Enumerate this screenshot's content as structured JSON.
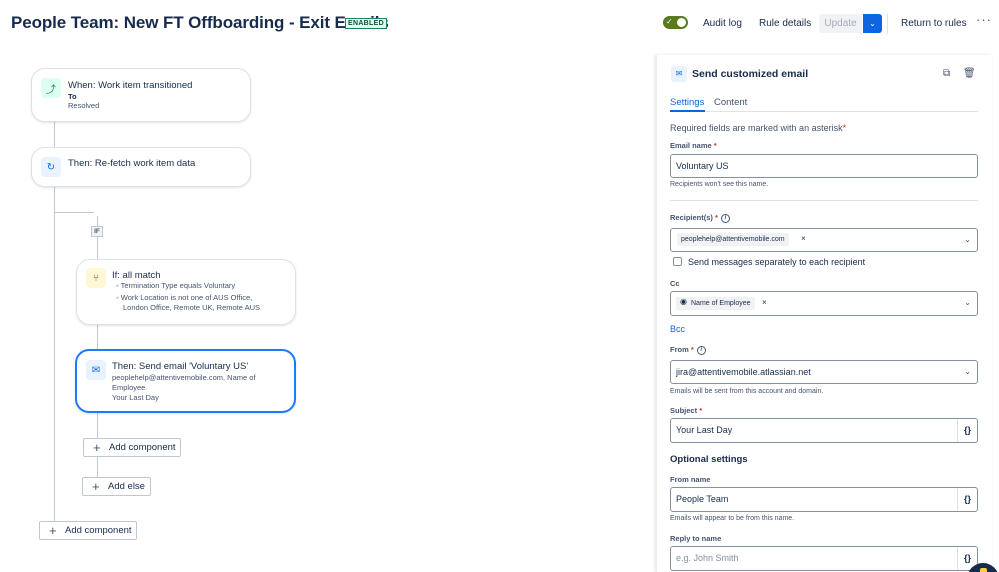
{
  "header": {
    "title": "People Team: New FT Offboarding - Exit Emails",
    "status_badge": "ENABLED",
    "audit_log": "Audit log",
    "rule_details": "Rule details",
    "update": "Update",
    "return_to_rules": "Return to rules"
  },
  "canvas": {
    "trigger": {
      "title": "When: Work item transitioned",
      "to_label": "To",
      "to_value": "Resolved"
    },
    "refetch": {
      "title": "Then: Re-fetch work item data"
    },
    "if_chip": "IF",
    "condition": {
      "title": "If: all match",
      "items": [
        "Termination Type equals Voluntary",
        "Work Location is not one of AUS Office,",
        "London Office, Remote UK, Remote AUS"
      ]
    },
    "send_email": {
      "title": "Then: Send email 'Voluntary US'",
      "lines": [
        "peoplehelp@attentivemobile.com, Name of",
        "Employee",
        "Your Last Day"
      ]
    },
    "add_component_inner": "Add component",
    "add_else": "Add else",
    "add_component_outer": "Add component"
  },
  "panel": {
    "title": "Send customized email",
    "tabs": [
      "Settings",
      "Content"
    ],
    "required_note": "Required fields are marked with an asterisk",
    "email_name": {
      "label": "Email name",
      "value": "Voluntary US",
      "help": "Recipients won't see this name."
    },
    "recipients": {
      "label": "Recipient(s)",
      "chip": "peoplehelp@attentivemobile.com",
      "chip_remove": "×"
    },
    "send_separately": "Send messages separately to each recipient",
    "cc": {
      "label": "Cc",
      "chip": "Name of Employee",
      "chip_remove": "×"
    },
    "bcc": "Bcc",
    "from": {
      "label": "From",
      "value": "jira@attentivemobile.atlassian.net",
      "help": "Emails will be sent from this account and domain."
    },
    "subject": {
      "label": "Subject",
      "value": "Your Last Day"
    },
    "optional_heading": "Optional settings",
    "from_name": {
      "label": "From name",
      "value": "People Team",
      "help": "Emails will appear to be from this name."
    },
    "reply_to_name": {
      "label": "Reply to name",
      "placeholder": "e.g. John Smith"
    },
    "required_star": "*",
    "brace_symbol": "{}"
  },
  "colors": {
    "accent": "#0c66e4",
    "toggle_on": "#5a7a1f",
    "badge_green": "#1f845a"
  }
}
